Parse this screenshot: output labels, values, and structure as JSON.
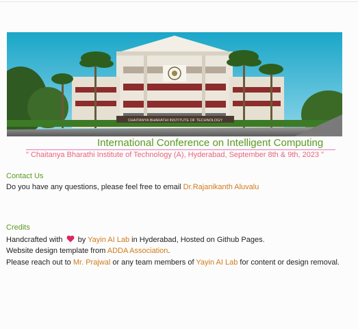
{
  "header": {
    "banner_sign": "CHAITANYA BHARATHI INSTITUTE OF TECHNOLOGY",
    "title": "International Conference on Intelligent Computing",
    "subtitle": "\" Chaitanya Bharathi Institute of Technology (A), Hyderabad, September 8th & 9th, 2023 \""
  },
  "contact": {
    "heading": "Contact Us",
    "text": "Do you have any questions, please feel free to email",
    "link": "Dr.Rajanikanth Aluvalu"
  },
  "credits": {
    "heading": "Credits",
    "line1_before": "Handcrafted with",
    "line1_by": "by",
    "line1_link": "Yayin AI Lab",
    "line1_after": "in Hyderabad, Hosted on Github Pages.",
    "line2_before": "Website design template from",
    "line2_link": "ADDA Association",
    "line2_after": ".",
    "line3_before": "Please reach out to",
    "line3_link1": "Mr. Prajwal",
    "line3_middle": "or any team members of",
    "line3_link2": "Yayin AI Lab",
    "line3_after": "for content or design removal."
  },
  "colors": {
    "accent_green": "#5a9a1f",
    "subtitle_pink": "#e8637a",
    "link_orange": "#d07a1c",
    "heart_red": "#e0245e"
  },
  "icons": {
    "heart": "heart-icon",
    "college_logo": "college-emblem-icon"
  }
}
